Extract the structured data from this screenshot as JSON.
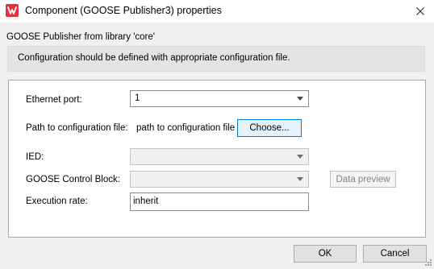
{
  "window": {
    "title": "Component (GOOSE Publisher3) properties",
    "close_glyph": "✕"
  },
  "library_label": "GOOSE Publisher from library 'core'",
  "info_message": "Configuration should be defined with appropriate configuration file.",
  "form": {
    "ethernet_port": {
      "label": "Ethernet port:",
      "value": "1"
    },
    "config_path": {
      "label": "Path to configuration file:",
      "value": "path to configuration file",
      "button_label": "Choose..."
    },
    "ied": {
      "label": "IED:",
      "value": ""
    },
    "goose_control_block": {
      "label": "GOOSE Control Block:",
      "value": "",
      "button_label": "Data preview"
    },
    "execution_rate": {
      "label": "Execution rate:",
      "value": "inherit"
    }
  },
  "footer": {
    "ok_label": "OK",
    "cancel_label": "Cancel"
  },
  "colors": {
    "app_icon": "#e8303a",
    "focus_border": "#0078d7",
    "window_background": "#f0f0f0"
  },
  "icons": {
    "app": "app-logo-icon",
    "close": "close-icon",
    "dropdown": "chevron-down-icon",
    "grip": "resize-grip-icon"
  }
}
